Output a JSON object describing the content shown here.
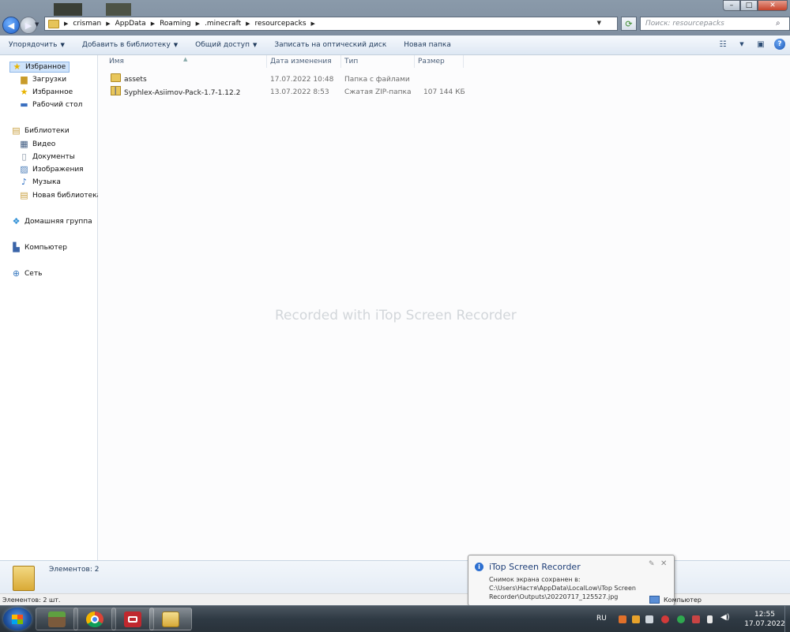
{
  "breadcrumb": [
    "crisman",
    "AppData",
    "Roaming",
    ".minecraft",
    "resourcepacks"
  ],
  "search": {
    "placeholder": "Поиск: resourcepacks"
  },
  "window": {
    "minimize": "–",
    "maximize": "□",
    "close": "✕"
  },
  "toolbar": {
    "organize": "Упорядочить",
    "add_to_library": "Добавить в библиотеку",
    "share": "Общий доступ",
    "burn": "Записать на оптический диск",
    "new_folder": "Новая папка",
    "help": "?"
  },
  "sidebar": {
    "favorites": {
      "header": "Избранное",
      "items": [
        "Загрузки",
        "Избранное",
        "Рабочий стол"
      ]
    },
    "libraries": {
      "header": "Библиотеки",
      "items": [
        "Видео",
        "Документы",
        "Изображения",
        "Музыка",
        "Новая библиотека"
      ]
    },
    "homegroup": "Домашняя группа",
    "computer": "Компьютер",
    "network": "Сеть"
  },
  "columns": {
    "name": "Имя",
    "date": "Дата изменения",
    "type": "Тип",
    "size": "Размер"
  },
  "files": [
    {
      "name": "assets",
      "date": "17.07.2022 10:48",
      "type": "Папка с файлами",
      "size": ""
    },
    {
      "name": "Syphlex-Asiimov-Pack-1.7-1.12.2",
      "date": "13.07.2022 8:53",
      "type": "Сжатая ZIP-папка",
      "size": "107 144 КБ"
    }
  ],
  "watermark": "Recorded with iTop Screen Recorder",
  "details": {
    "count": "Элементов: 2"
  },
  "status": {
    "text": "Элементов: 2 шт."
  },
  "notification": {
    "title": "iTop Screen Recorder",
    "body": "Снимок экрана сохранен в: C:\\Users\\Настя\\AppData\\LocalLow\\iTop Screen Recorder\\Outputs\\20220717_125527.jpg"
  },
  "taskbar": {
    "language": "RU",
    "tray_label": "Компьютер",
    "time": "12:55",
    "date": "17.07.2022"
  },
  "colors": {
    "accent": "#1e395b",
    "selection": "#cfe3fa",
    "taskbar": "#2f3a44"
  }
}
